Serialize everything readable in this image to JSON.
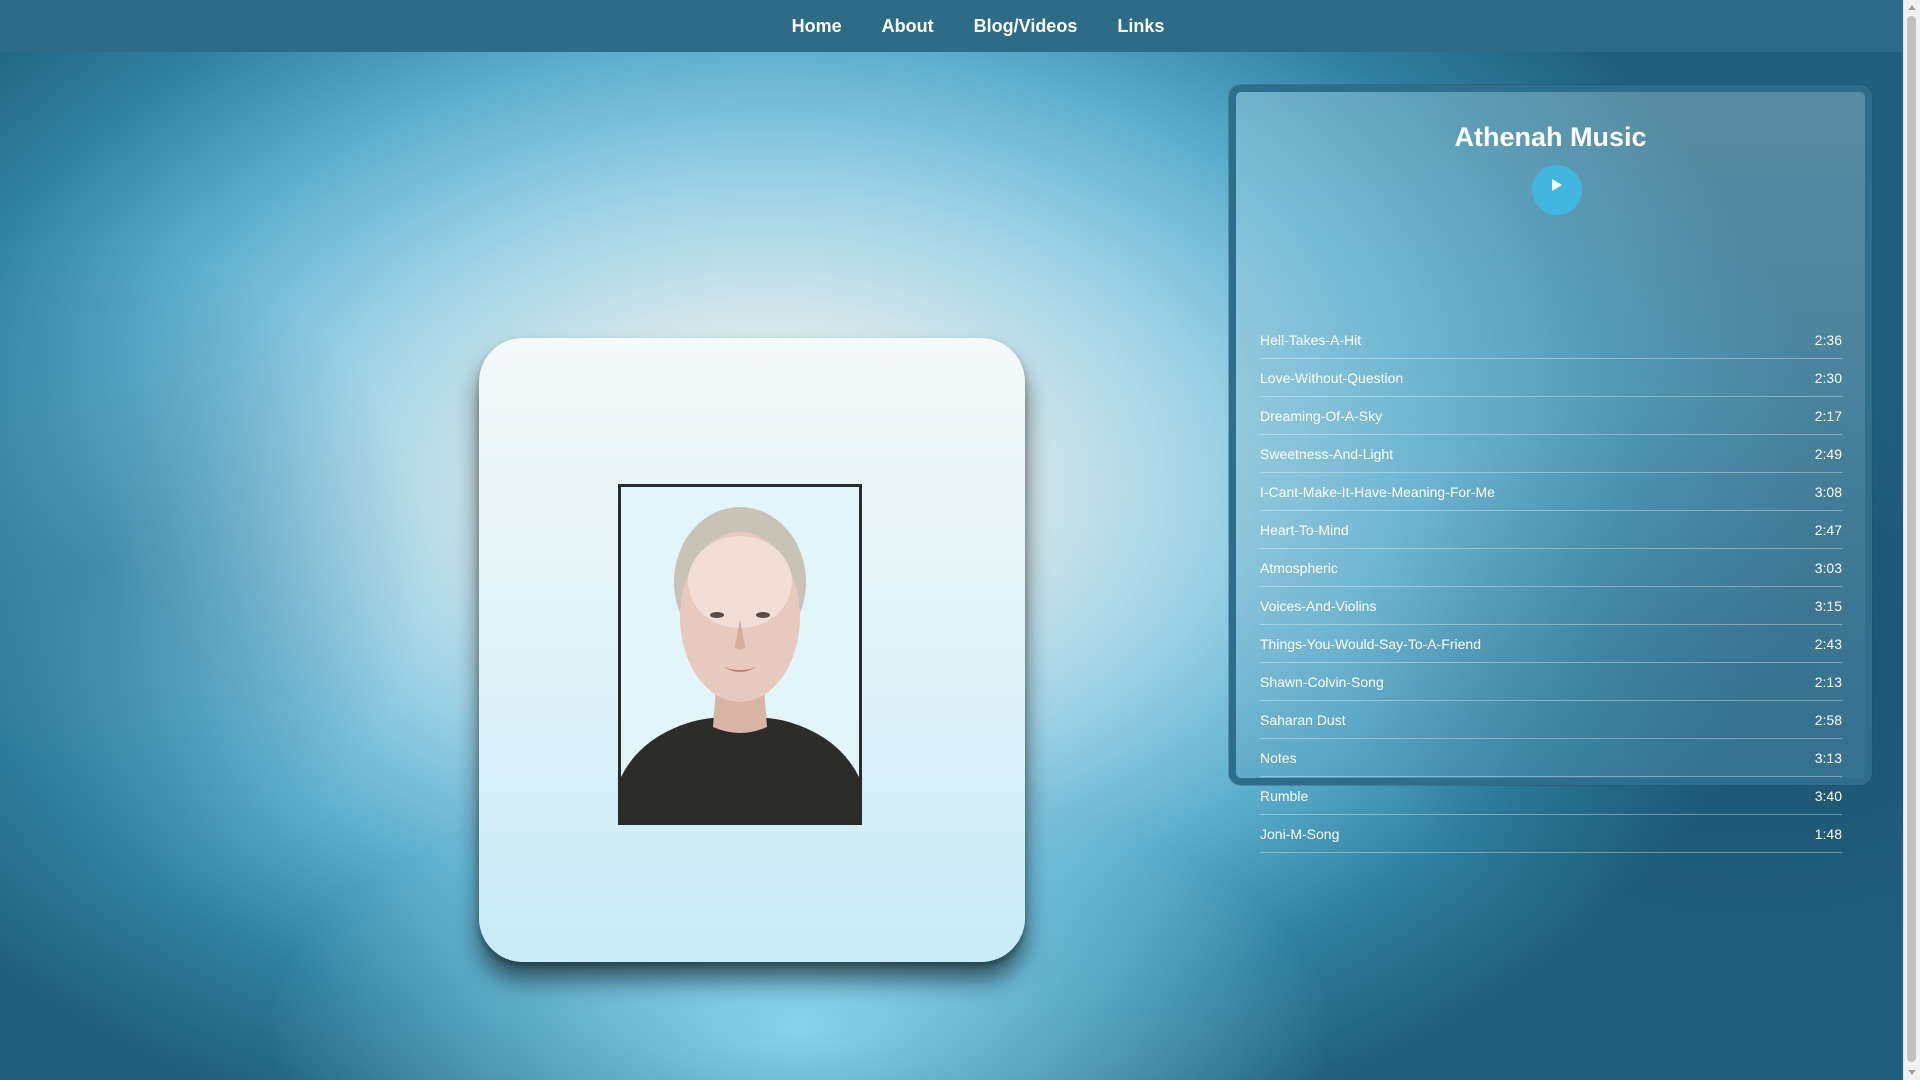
{
  "nav": {
    "items": [
      {
        "label": "Home"
      },
      {
        "label": "About"
      },
      {
        "label": "Blog/Videos"
      },
      {
        "label": "Links"
      }
    ]
  },
  "player": {
    "title": "Athenah Music",
    "play_icon": "play-icon",
    "tracks": [
      {
        "title": "Hell-Takes-A-Hit",
        "duration": "2:36"
      },
      {
        "title": "Love-Without-Question",
        "duration": "2:30"
      },
      {
        "title": "Dreaming-Of-A-Sky",
        "duration": "2:17"
      },
      {
        "title": "Sweetness-And-Light",
        "duration": "2:49"
      },
      {
        "title": "I-Cant-Make-It-Have-Meaning-For-Me",
        "duration": "3:08"
      },
      {
        "title": "Heart-To-Mind",
        "duration": "2:47"
      },
      {
        "title": "Atmospheric",
        "duration": "3:03"
      },
      {
        "title": "Voices-And-Violins",
        "duration": "3:15"
      },
      {
        "title": "Things-You-Would-Say-To-A-Friend",
        "duration": "2:43"
      },
      {
        "title": "Shawn-Colvin-Song",
        "duration": "2:13"
      },
      {
        "title": "Saharan Dust",
        "duration": "2:58"
      },
      {
        "title": "Notes",
        "duration": "3:13"
      },
      {
        "title": "Rumble",
        "duration": "3:40"
      },
      {
        "title": "Joni-M-Song",
        "duration": "1:48"
      }
    ]
  },
  "colors": {
    "nav_background": "#2d6c86",
    "player_border": "#2f6e8a",
    "play_button": "#43b6e0"
  }
}
